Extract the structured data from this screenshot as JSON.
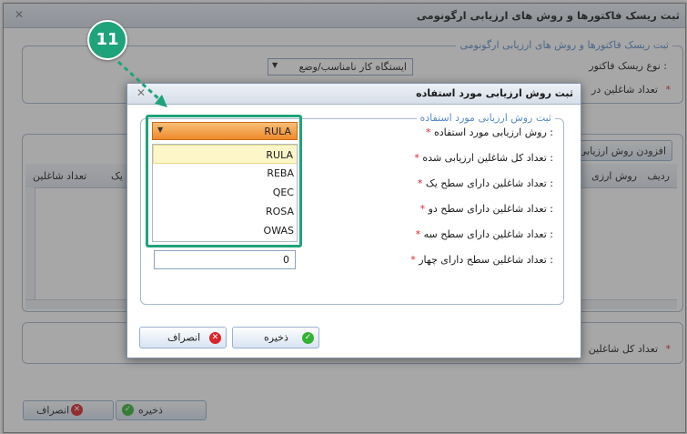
{
  "bg": {
    "title": "ثبت ریسک فاکتورها و روش های ارزیابی ارگونومی",
    "legend": "ثبت ریسک فاکتورها و روش های ارزیابی ارگونومی",
    "risk_factor_label": "نوع ریسک فاکتور :",
    "risk_factor_value": "ایستگاه کار نامناسب/وضع",
    "workers_label": "تعداد شاغلین در",
    "add_method_button": "افزودن روش ارزیابی",
    "grid_headers": [
      "ردیف",
      "روش ارزی",
      "شاغلین سطح یک",
      "تعداد شاغلین"
    ],
    "total_label": "تعداد کل شاغلین",
    "save_button": "ذخیره",
    "cancel_button": "انصراف"
  },
  "callout": {
    "number": "11"
  },
  "dialog": {
    "title": "ثبت روش ارزیابی مورد استفاده",
    "legend": "ثبت روش ارزیابی مورد استفاده",
    "labels": [
      "روش ارزیابی مورد استفاده :",
      "تعداد کل شاغلین ارزیابی شده :",
      "تعداد شاغلین دارای سطح یک :",
      "تعداد شاغلین دارای سطح دو :",
      "تعداد شاغلین دارای سطح سه :",
      "تعداد شاغلین سطح دارای چهار :"
    ],
    "method_selected": "RULA",
    "method_options": [
      "RULA",
      "REBA",
      "QEC",
      "ROSA",
      "OWAS"
    ],
    "level4_value": "0",
    "save_button": "ذخیره",
    "cancel_button": "انصراف"
  },
  "colors": {
    "accent": "#1fa37a",
    "dropdown_selected": "#f19a3a",
    "highlight_row": "#fdf6c8"
  }
}
